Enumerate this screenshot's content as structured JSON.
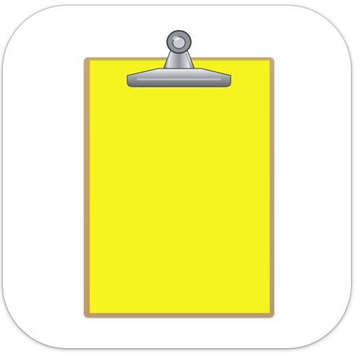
{
  "icon": {
    "name": "clipboard-app-icon",
    "colors": {
      "background": "#ffffff",
      "board": "#c7a67a",
      "paper": "#f6f41f",
      "clip": "#9ea2a8"
    }
  }
}
